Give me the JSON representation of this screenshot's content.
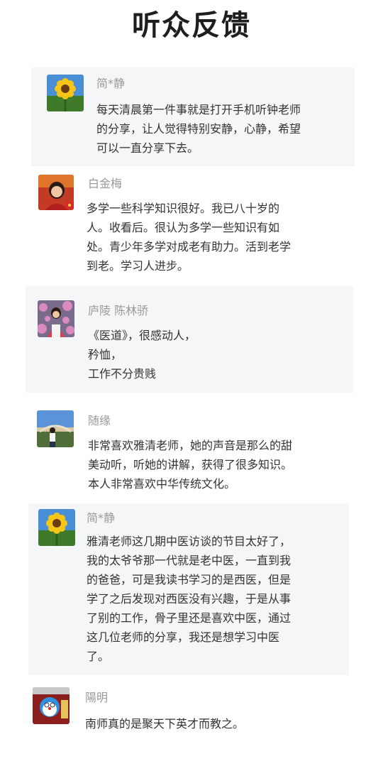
{
  "page": {
    "title": "听众反馈"
  },
  "feedback": [
    {
      "name": "简*静",
      "avatar_icon": "sunflower-avatar-icon",
      "lines": [
        "每天清晨第一件事就是打开手机听钟老师",
        "的分享，让人觉得特别安静，心静，希望",
        "可以一直分享下去。"
      ]
    },
    {
      "name": "白金梅",
      "avatar_icon": "woman-portrait-avatar-icon",
      "lines": [
        "多学一些科学知识很好。我已八十岁的",
        "人。收看后。很认为多学一些知识有如",
        "处。青少年多学对成老有助力。活到老学",
        "到老。学习人进步。"
      ]
    },
    {
      "name": "庐陵 陈林骄",
      "avatar_icon": "woman-flowers-avatar-icon",
      "lines": [
        "《医道》，很感动人，",
        "矜恤，",
        "工作不分贵贱"
      ]
    },
    {
      "name": "随缘",
      "avatar_icon": "person-outdoors-avatar-icon",
      "lines": [
        "非常喜欢雅清老师，她的声音是那么的甜",
        "美动听，听她的讲解，获得了很多知识。",
        "本人非常喜欢中华传统文化。"
      ]
    },
    {
      "name": "简*静",
      "avatar_icon": "sunflower-avatar-icon",
      "lines": [
        "雅清老师这几期中医访谈的节目太好了，",
        "我的太爷爷那一代就是老中医，一直到我",
        "的爸爸，可是我读书学习的是西医，但是",
        "学了之后发现对西医没有兴趣，于是从事",
        "了别的工作，骨子里还是喜欢中医，通过",
        "这几位老师的分享，我还是想学习中医",
        "了。"
      ]
    },
    {
      "name": "陽明",
      "avatar_icon": "cartoon-robot-avatar-icon",
      "lines": [
        "南师真的是聚天下英才而教之。"
      ]
    }
  ]
}
